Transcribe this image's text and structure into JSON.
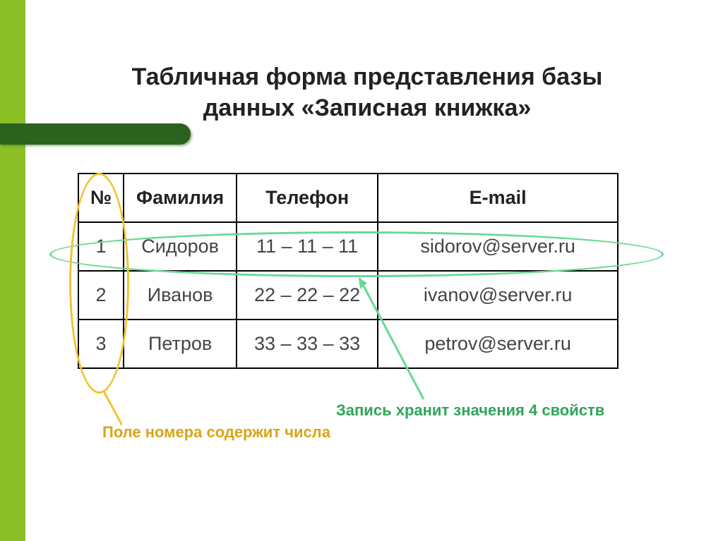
{
  "title": "Табличная форма представления базы данных «Записная книжка»",
  "table": {
    "headers": [
      "№",
      "Фамилия",
      "Телефон",
      "E-mail"
    ],
    "rows": [
      [
        "1",
        "Сидоров",
        "11 – 11 – 11",
        "sidorov@server.ru"
      ],
      [
        "2",
        "Иванов",
        "22 – 22 – 22",
        "ivanov@server.ru"
      ],
      [
        "3",
        "Петров",
        "33 – 33 – 33",
        "petrov@server.ru"
      ]
    ]
  },
  "callouts": {
    "field": "Поле номера содержит числа",
    "record": "Запись хранит значения 4 свойств"
  }
}
